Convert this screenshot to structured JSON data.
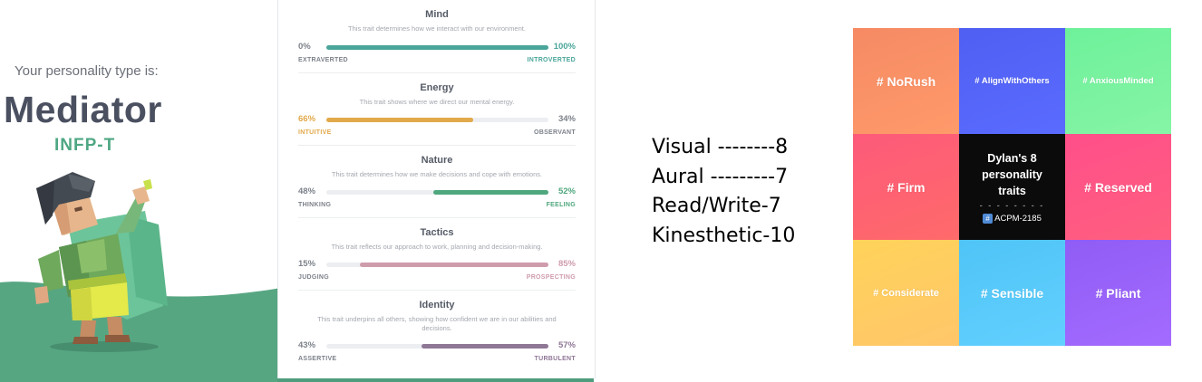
{
  "hero": {
    "intro": "Your personality type is:",
    "type_name": "Mediator",
    "type_code": "INFP-T",
    "colors": {
      "accent": "#4fa783",
      "hill": "#57a682"
    }
  },
  "traits": [
    {
      "name": "Mind",
      "description": "This trait determines how we interact with our environment.",
      "left_value": "0%",
      "right_value": "100%",
      "left_label": "EXTRAVERTED",
      "right_label": "INTROVERTED",
      "dominant": "right",
      "right_fraction": 1.0,
      "color": "#4aa59a"
    },
    {
      "name": "Energy",
      "description": "This trait shows where we direct our mental energy.",
      "left_value": "66%",
      "right_value": "34%",
      "left_label": "INTUITIVE",
      "right_label": "OBSERVANT",
      "dominant": "left",
      "left_fraction": 0.66,
      "color": "#e2a94a"
    },
    {
      "name": "Nature",
      "description": "This trait determines how we make decisions and cope with emotions.",
      "left_value": "48%",
      "right_value": "52%",
      "left_label": "THINKING",
      "right_label": "FEELING",
      "dominant": "right",
      "right_fraction": 0.52,
      "color": "#4fa77e"
    },
    {
      "name": "Tactics",
      "description": "This trait reflects our approach to work, planning and decision-making.",
      "left_value": "15%",
      "right_value": "85%",
      "left_label": "JUDGING",
      "right_label": "PROSPECTING",
      "dominant": "right",
      "right_fraction": 0.85,
      "color": "#cf9cac"
    },
    {
      "name": "Identity",
      "description": "This trait underpins all others, showing how confident we are in our abilities and decisions.",
      "left_value": "43%",
      "right_value": "57%",
      "left_label": "ASSERTIVE",
      "right_label": "TURBULENT",
      "dominant": "right",
      "right_fraction": 0.57,
      "color": "#8f7796"
    }
  ],
  "learning_styles": [
    "Visual --------8",
    "Aural ---------7",
    "Read/Write-7",
    "Kinesthetic-10"
  ],
  "traits_grid": {
    "center": {
      "title": "Dylan's 8 personality traits",
      "separator": "- - - - - - - -",
      "handle": "ACPM-2185"
    },
    "tiles": [
      {
        "label": "# NoRush",
        "color_top": "#f58a64",
        "color_bottom": "#ff9a6a"
      },
      {
        "label": "# AlignWithOthers",
        "color_top": "#4f5ff2",
        "color_bottom": "#5a6bff"
      },
      {
        "label": "# AnxiousMinded",
        "color_top": "#6ef19a",
        "color_bottom": "#86f4a6"
      },
      {
        "label": "# Firm",
        "color_top": "#fd5a7a",
        "color_bottom": "#ff6a6a"
      },
      {
        "label": "# Reserved",
        "color_top": "#ff4f8a",
        "color_bottom": "#ff5f7f"
      },
      {
        "label": "# Considerate",
        "color_top": "#ffd35a",
        "color_bottom": "#ffc66a"
      },
      {
        "label": "# Sensible",
        "color_top": "#4fc4f6",
        "color_bottom": "#62d0ff"
      },
      {
        "label": "# Pliant",
        "color_top": "#8f5cf5",
        "color_bottom": "#a46bff"
      }
    ]
  }
}
